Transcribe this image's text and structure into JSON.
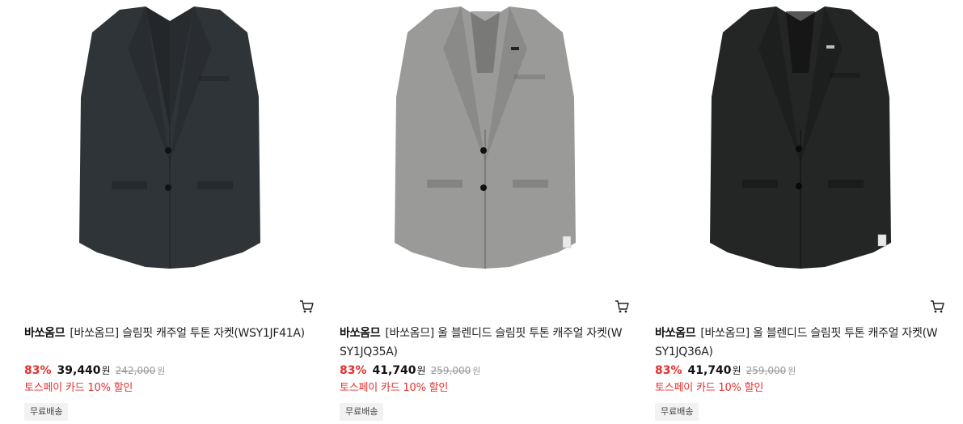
{
  "products": [
    {
      "brand": "바쏘옴므",
      "name": "[바쏘옴므] 슬림핏 캐주얼 투톤 자켓(WSY1JF41A)",
      "discount": "83%",
      "price": "39,440",
      "price_unit": "원",
      "original_price": "242,000",
      "original_unit": "원",
      "promo": "토스페이 카드 10% 할인",
      "shipping_badge": "무료배송",
      "image": "product-photo-charcoal-jacket",
      "jacket_color": "#2f3438"
    },
    {
      "brand": "바쏘옴므",
      "name": "[바쏘옴므] 울 블렌디드 슬림핏 투톤 캐주얼 자켓(WSY1JQ35A)",
      "discount": "83%",
      "price": "41,740",
      "price_unit": "원",
      "original_price": "259,000",
      "original_unit": "원",
      "promo": "토스페이 카드 10% 할인",
      "shipping_badge": "무료배송",
      "image": "product-photo-grey-jacket",
      "jacket_color": "#9a9a98"
    },
    {
      "brand": "바쏘옴므",
      "name": "[바쏘옴므] 울 블렌디드 슬림핏 투톤 캐주얼 자켓(WSY1JQ36A)",
      "discount": "83%",
      "price": "41,740",
      "price_unit": "원",
      "original_price": "259,000",
      "original_unit": "원",
      "promo": "토스페이 카드 10% 할인",
      "shipping_badge": "무료배송",
      "image": "product-photo-black-jacket",
      "jacket_color": "#232624"
    }
  ],
  "colors": {
    "discount": "#e4302f",
    "promo": "#e4302f",
    "badge_bg": "#f2f2f2",
    "original_price": "#999999"
  },
  "icons": {
    "cart": "shopping-cart-icon"
  }
}
